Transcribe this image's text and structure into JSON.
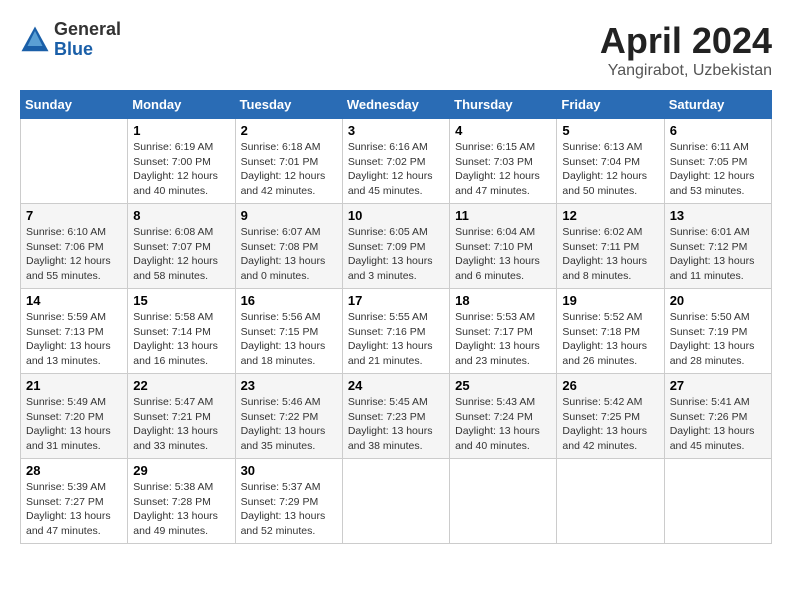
{
  "header": {
    "logo_general": "General",
    "logo_blue": "Blue",
    "month_title": "April 2024",
    "location": "Yangirabot, Uzbekistan"
  },
  "days_of_week": [
    "Sunday",
    "Monday",
    "Tuesday",
    "Wednesday",
    "Thursday",
    "Friday",
    "Saturday"
  ],
  "weeks": [
    [
      {
        "day": "",
        "sunrise": "",
        "sunset": "",
        "daylight": ""
      },
      {
        "day": "1",
        "sunrise": "Sunrise: 6:19 AM",
        "sunset": "Sunset: 7:00 PM",
        "daylight": "Daylight: 12 hours and 40 minutes."
      },
      {
        "day": "2",
        "sunrise": "Sunrise: 6:18 AM",
        "sunset": "Sunset: 7:01 PM",
        "daylight": "Daylight: 12 hours and 42 minutes."
      },
      {
        "day": "3",
        "sunrise": "Sunrise: 6:16 AM",
        "sunset": "Sunset: 7:02 PM",
        "daylight": "Daylight: 12 hours and 45 minutes."
      },
      {
        "day": "4",
        "sunrise": "Sunrise: 6:15 AM",
        "sunset": "Sunset: 7:03 PM",
        "daylight": "Daylight: 12 hours and 47 minutes."
      },
      {
        "day": "5",
        "sunrise": "Sunrise: 6:13 AM",
        "sunset": "Sunset: 7:04 PM",
        "daylight": "Daylight: 12 hours and 50 minutes."
      },
      {
        "day": "6",
        "sunrise": "Sunrise: 6:11 AM",
        "sunset": "Sunset: 7:05 PM",
        "daylight": "Daylight: 12 hours and 53 minutes."
      }
    ],
    [
      {
        "day": "7",
        "sunrise": "Sunrise: 6:10 AM",
        "sunset": "Sunset: 7:06 PM",
        "daylight": "Daylight: 12 hours and 55 minutes."
      },
      {
        "day": "8",
        "sunrise": "Sunrise: 6:08 AM",
        "sunset": "Sunset: 7:07 PM",
        "daylight": "Daylight: 12 hours and 58 minutes."
      },
      {
        "day": "9",
        "sunrise": "Sunrise: 6:07 AM",
        "sunset": "Sunset: 7:08 PM",
        "daylight": "Daylight: 13 hours and 0 minutes."
      },
      {
        "day": "10",
        "sunrise": "Sunrise: 6:05 AM",
        "sunset": "Sunset: 7:09 PM",
        "daylight": "Daylight: 13 hours and 3 minutes."
      },
      {
        "day": "11",
        "sunrise": "Sunrise: 6:04 AM",
        "sunset": "Sunset: 7:10 PM",
        "daylight": "Daylight: 13 hours and 6 minutes."
      },
      {
        "day": "12",
        "sunrise": "Sunrise: 6:02 AM",
        "sunset": "Sunset: 7:11 PM",
        "daylight": "Daylight: 13 hours and 8 minutes."
      },
      {
        "day": "13",
        "sunrise": "Sunrise: 6:01 AM",
        "sunset": "Sunset: 7:12 PM",
        "daylight": "Daylight: 13 hours and 11 minutes."
      }
    ],
    [
      {
        "day": "14",
        "sunrise": "Sunrise: 5:59 AM",
        "sunset": "Sunset: 7:13 PM",
        "daylight": "Daylight: 13 hours and 13 minutes."
      },
      {
        "day": "15",
        "sunrise": "Sunrise: 5:58 AM",
        "sunset": "Sunset: 7:14 PM",
        "daylight": "Daylight: 13 hours and 16 minutes."
      },
      {
        "day": "16",
        "sunrise": "Sunrise: 5:56 AM",
        "sunset": "Sunset: 7:15 PM",
        "daylight": "Daylight: 13 hours and 18 minutes."
      },
      {
        "day": "17",
        "sunrise": "Sunrise: 5:55 AM",
        "sunset": "Sunset: 7:16 PM",
        "daylight": "Daylight: 13 hours and 21 minutes."
      },
      {
        "day": "18",
        "sunrise": "Sunrise: 5:53 AM",
        "sunset": "Sunset: 7:17 PM",
        "daylight": "Daylight: 13 hours and 23 minutes."
      },
      {
        "day": "19",
        "sunrise": "Sunrise: 5:52 AM",
        "sunset": "Sunset: 7:18 PM",
        "daylight": "Daylight: 13 hours and 26 minutes."
      },
      {
        "day": "20",
        "sunrise": "Sunrise: 5:50 AM",
        "sunset": "Sunset: 7:19 PM",
        "daylight": "Daylight: 13 hours and 28 minutes."
      }
    ],
    [
      {
        "day": "21",
        "sunrise": "Sunrise: 5:49 AM",
        "sunset": "Sunset: 7:20 PM",
        "daylight": "Daylight: 13 hours and 31 minutes."
      },
      {
        "day": "22",
        "sunrise": "Sunrise: 5:47 AM",
        "sunset": "Sunset: 7:21 PM",
        "daylight": "Daylight: 13 hours and 33 minutes."
      },
      {
        "day": "23",
        "sunrise": "Sunrise: 5:46 AM",
        "sunset": "Sunset: 7:22 PM",
        "daylight": "Daylight: 13 hours and 35 minutes."
      },
      {
        "day": "24",
        "sunrise": "Sunrise: 5:45 AM",
        "sunset": "Sunset: 7:23 PM",
        "daylight": "Daylight: 13 hours and 38 minutes."
      },
      {
        "day": "25",
        "sunrise": "Sunrise: 5:43 AM",
        "sunset": "Sunset: 7:24 PM",
        "daylight": "Daylight: 13 hours and 40 minutes."
      },
      {
        "day": "26",
        "sunrise": "Sunrise: 5:42 AM",
        "sunset": "Sunset: 7:25 PM",
        "daylight": "Daylight: 13 hours and 42 minutes."
      },
      {
        "day": "27",
        "sunrise": "Sunrise: 5:41 AM",
        "sunset": "Sunset: 7:26 PM",
        "daylight": "Daylight: 13 hours and 45 minutes."
      }
    ],
    [
      {
        "day": "28",
        "sunrise": "Sunrise: 5:39 AM",
        "sunset": "Sunset: 7:27 PM",
        "daylight": "Daylight: 13 hours and 47 minutes."
      },
      {
        "day": "29",
        "sunrise": "Sunrise: 5:38 AM",
        "sunset": "Sunset: 7:28 PM",
        "daylight": "Daylight: 13 hours and 49 minutes."
      },
      {
        "day": "30",
        "sunrise": "Sunrise: 5:37 AM",
        "sunset": "Sunset: 7:29 PM",
        "daylight": "Daylight: 13 hours and 52 minutes."
      },
      {
        "day": "",
        "sunrise": "",
        "sunset": "",
        "daylight": ""
      },
      {
        "day": "",
        "sunrise": "",
        "sunset": "",
        "daylight": ""
      },
      {
        "day": "",
        "sunrise": "",
        "sunset": "",
        "daylight": ""
      },
      {
        "day": "",
        "sunrise": "",
        "sunset": "",
        "daylight": ""
      }
    ]
  ]
}
